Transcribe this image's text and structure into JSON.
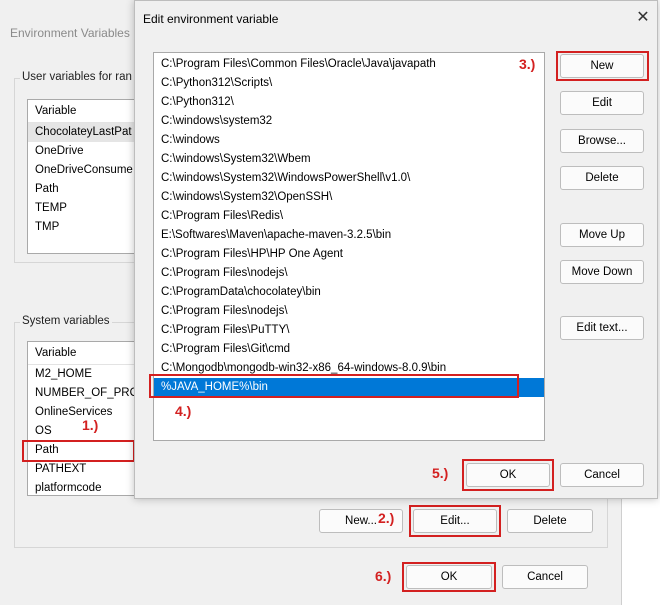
{
  "background_window": {
    "title": "Environment Variables",
    "user_group_label": "User variables for ran",
    "user_list": {
      "header": "Variable",
      "items": [
        "ChocolateyLastPat",
        "OneDrive",
        "OneDriveConsume",
        "Path",
        "TEMP",
        "TMP"
      ]
    },
    "system_group_label": "System variables",
    "system_list": {
      "header": "Variable",
      "items": [
        "M2_HOME",
        "NUMBER_OF_PROC",
        "OnlineServices",
        "OS",
        "Path",
        "PATHEXT",
        "platformcode"
      ]
    },
    "buttons": {
      "new": "New...",
      "edit": "Edit...",
      "delete": "Delete",
      "ok": "OK",
      "cancel": "Cancel"
    }
  },
  "dialog": {
    "title": "Edit environment variable",
    "close_glyph": "✕",
    "paths": [
      "C:\\Program Files\\Common Files\\Oracle\\Java\\javapath",
      "C:\\Python312\\Scripts\\",
      "C:\\Python312\\",
      "C:\\windows\\system32",
      "C:\\windows",
      "C:\\windows\\System32\\Wbem",
      "C:\\windows\\System32\\WindowsPowerShell\\v1.0\\",
      "C:\\windows\\System32\\OpenSSH\\",
      "C:\\Program Files\\Redis\\",
      "E:\\Softwares\\Maven\\apache-maven-3.2.5\\bin",
      "C:\\Program Files\\HP\\HP One Agent",
      "C:\\Program Files\\nodejs\\",
      "C:\\ProgramData\\chocolatey\\bin",
      "C:\\Program Files\\nodejs\\",
      "C:\\Program Files\\PuTTY\\",
      "C:\\Program Files\\Git\\cmd",
      "C:\\Mongodb\\mongodb-win32-x86_64-windows-8.0.9\\bin",
      "%JAVA_HOME%\\bin"
    ],
    "buttons": {
      "new": "New",
      "edit": "Edit",
      "browse": "Browse...",
      "delete": "Delete",
      "move_up": "Move Up",
      "move_down": "Move Down",
      "edit_text": "Edit text...",
      "ok": "OK",
      "cancel": "Cancel"
    }
  },
  "annotations": [
    "1.)",
    "2.)",
    "3.)",
    "4.)",
    "5.)",
    "6.)"
  ],
  "colors": {
    "callout": "#d32020",
    "selection": "#0078d7"
  }
}
